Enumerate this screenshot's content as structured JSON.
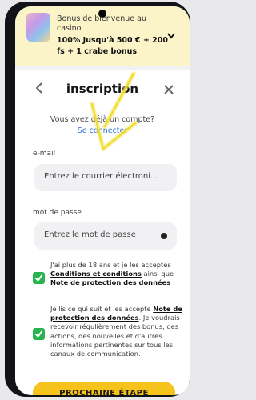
{
  "bonus": {
    "line1": "Bonus de bienvenue au casino",
    "line2": "100% Jusqu'à 500 € + 200 fs + 1 crabe bonus"
  },
  "header": {
    "title": "inscription",
    "have_account": "Vous avez déjà un compte?",
    "login_link": "Se connecter"
  },
  "form": {
    "email_label": "e-mail",
    "email_placeholder": "Entrez le courrier électroni...",
    "password_label": "mot de passe",
    "password_placeholder": "Entrez le mot de passe"
  },
  "consents": {
    "c1_text1": "J'ai plus de 18 ans et je les acceptes",
    "c1_link1": "Conditions et conditions",
    "c1_text2": "ainsi que",
    "c1_link2": "Note de protection des données",
    "c2_text1": "Je lis ce qui suit et les accepte",
    "c2_link": "Note de protection des données",
    "c2_text2": "Je voudrais recevoir régulièrement des bonus, des actions, des nouvelles et d'autres informations pertinentes sur tous les canaux de communication."
  },
  "actions": {
    "next_label": "PROCHAINE ÉTAPE"
  },
  "colors": {
    "accent_yellow": "#f6c21c",
    "check_green": "#29b34e",
    "link_blue": "#2c6fd6",
    "annotation_arrow": "#f7e96a"
  }
}
